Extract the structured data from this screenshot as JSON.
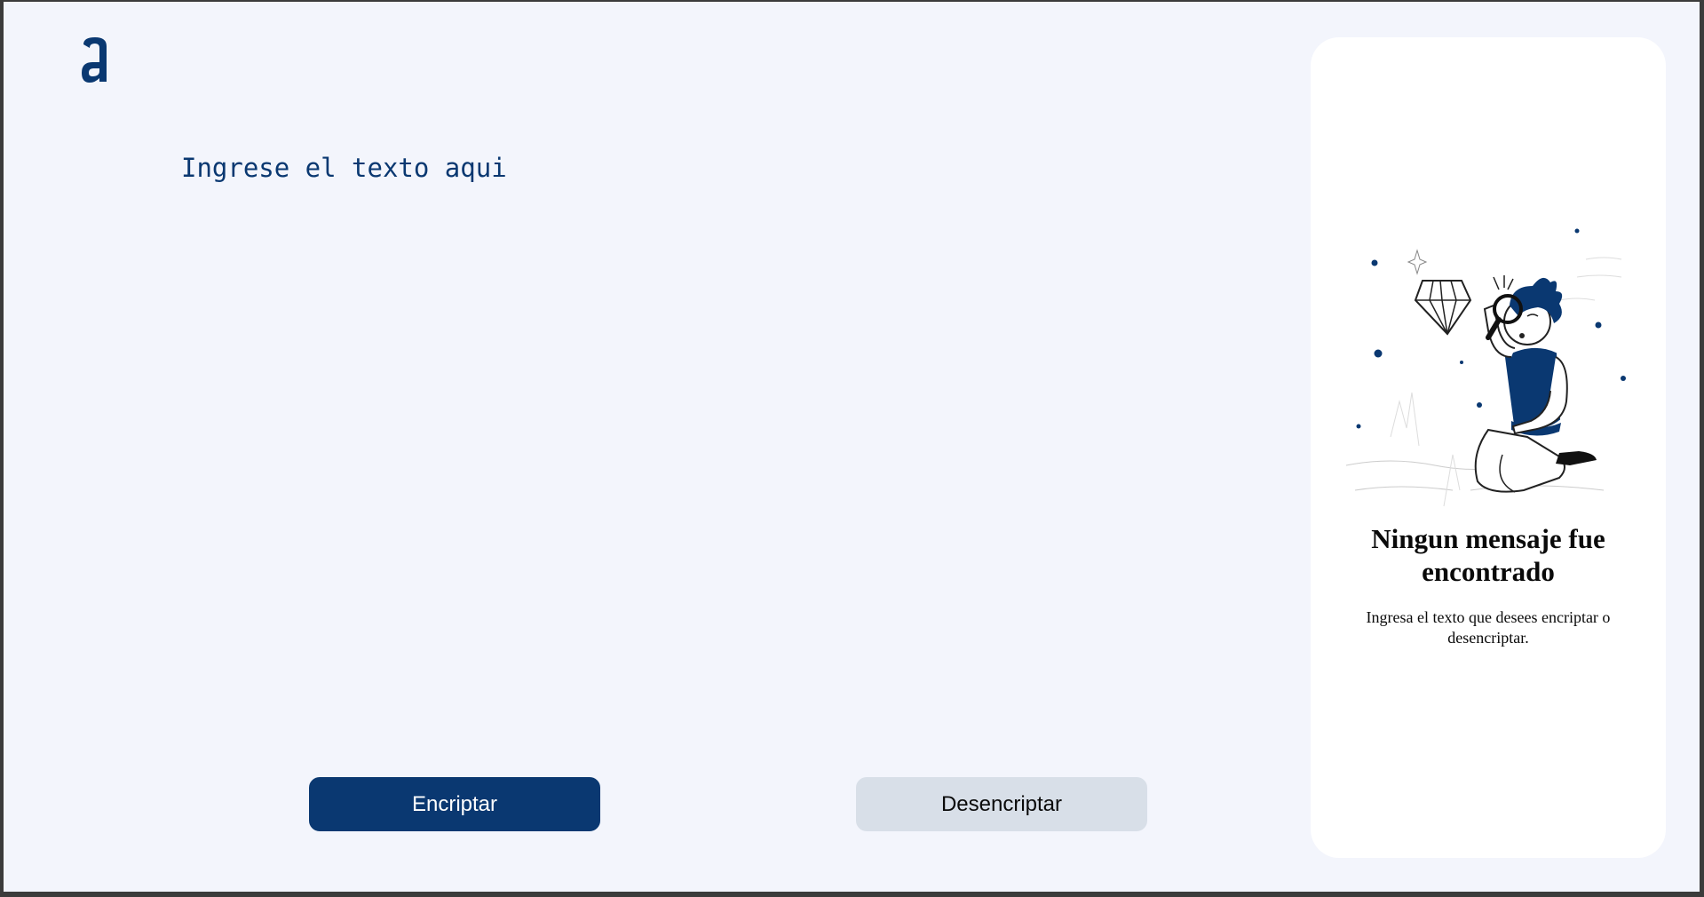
{
  "app": {
    "logo_icon": "alura-a-logo-icon",
    "accent_color": "#0a3871",
    "background_color": "#f3f5fc"
  },
  "input": {
    "placeholder": "Ingrese el texto aqui",
    "value": ""
  },
  "buttons": {
    "encrypt_label": "Encriptar",
    "decrypt_label": "Desencriptar"
  },
  "output_panel": {
    "illustration_icon": "person-with-magnifying-glass-illustration",
    "title": "Ningun mensaje fue encontrado",
    "message": "Ingresa el texto que desees encriptar o desencriptar."
  }
}
